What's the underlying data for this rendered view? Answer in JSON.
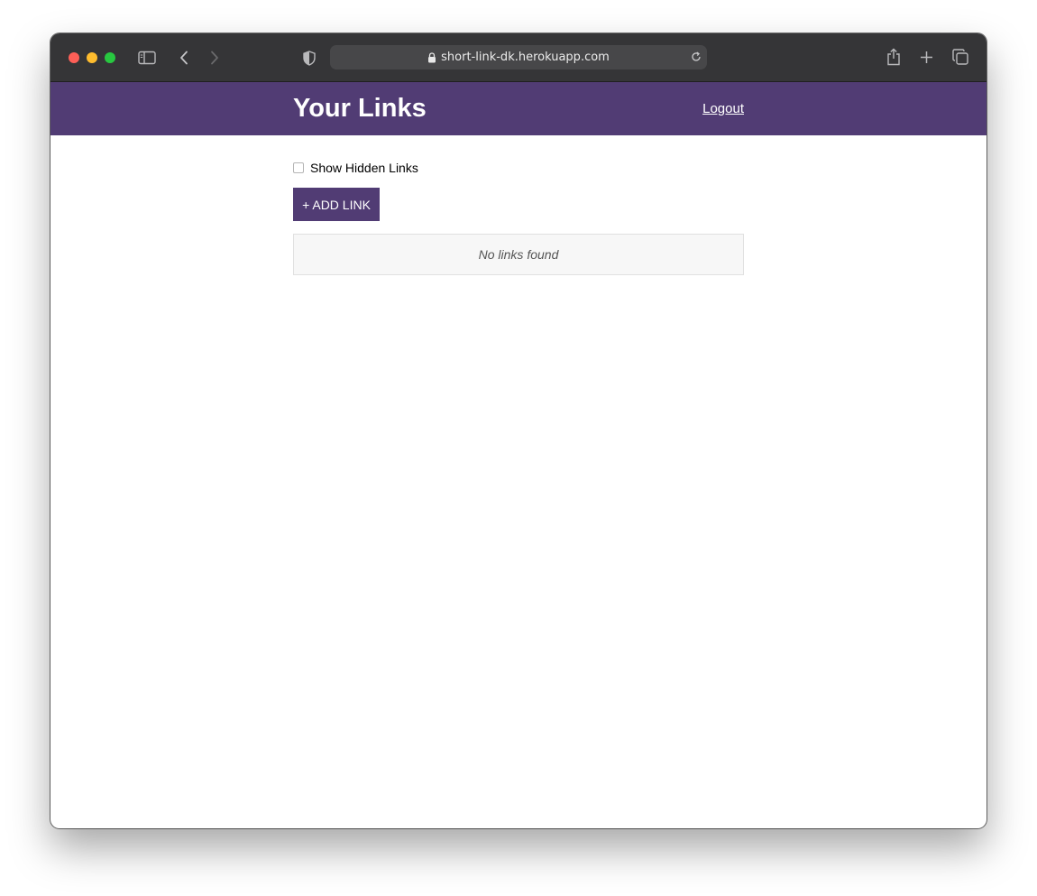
{
  "browser": {
    "url": "short-link-dk.herokuapp.com",
    "icons": {
      "sidebar": "sidebar-icon",
      "back": "chevron-left-icon",
      "forward": "chevron-right-icon",
      "privacy": "shield-icon",
      "lock": "lock-icon",
      "reload": "reload-icon",
      "share": "share-icon",
      "new_tab": "plus-icon",
      "tabs": "tabs-overview-icon"
    }
  },
  "header": {
    "title": "Your Links",
    "logout_label": "Logout"
  },
  "main": {
    "show_hidden_label": "Show Hidden Links",
    "show_hidden_checked": false,
    "add_button_label": "+ ADD LINK",
    "empty_message": "No links found"
  },
  "colors": {
    "accent": "#513c74",
    "titlebar": "#353537"
  }
}
